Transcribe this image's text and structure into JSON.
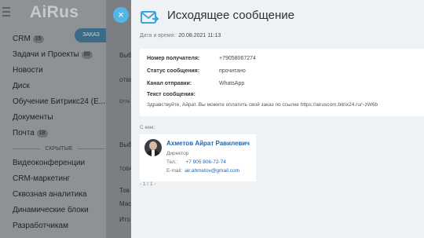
{
  "brand": {
    "logo": "AiRus"
  },
  "sidebar": {
    "order_button": "ЗАКАЗ",
    "items": [
      {
        "label": "CRM",
        "count": "15"
      },
      {
        "label": "Задачи и Проекты",
        "count": "89"
      },
      {
        "label": "Новости",
        "count": ""
      },
      {
        "label": "Диск",
        "count": ""
      },
      {
        "label": "Обучение Битрикс24 (E...",
        "count": ""
      },
      {
        "label": "Документы",
        "count": ""
      },
      {
        "label": "Почта",
        "count": "18"
      }
    ],
    "separator": "СКРЫТЫЕ",
    "hidden_items": [
      {
        "label": "Видеоконференции"
      },
      {
        "label": "CRM-маркетинг"
      },
      {
        "label": "Сквозная аналитика"
      },
      {
        "label": "Динамические блоки"
      },
      {
        "label": "Разработчикам"
      }
    ]
  },
  "background": {
    "fragments": [
      "Выб",
      "ОТВЕ",
      "Отте",
      "Выб",
      "ТОВА",
      "Тов",
      "Мас",
      "Ито"
    ]
  },
  "slider": {
    "close_glyph": "×",
    "title": "Исходящее сообщение",
    "datetime_label": "Дата и время:",
    "datetime_value": "20.08.2021 11:13",
    "details": {
      "recipient_label": "Номер получателя:",
      "recipient_value": "+79058067274",
      "status_label": "Статус сообщения:",
      "status_value": "прочитано",
      "channel_label": "Канал отправки:",
      "channel_value": "WhatsApp",
      "text_label": "Текст сообщения:",
      "text_value": "Здравствуйте, Айрат. Вы можете оплатить свой заказ по ссылке https://airuscom.bitrix24.ru/~zW6b"
    },
    "to_label": "С кем:",
    "contact": {
      "name": "Ахметов Айрат Равилевич",
      "position": "Директор",
      "phone_label": "Тел.:",
      "phone": "+7 905 806-72-74",
      "email_label": "E-mail:",
      "email": "air.ahmetov@gmail.com"
    },
    "pager": {
      "prev": "‹",
      "text": "1 / 1",
      "next": "›"
    }
  },
  "colors": {
    "accent": "#2067b0",
    "close": "#52b7e7",
    "envelope": "#3aa5de"
  }
}
